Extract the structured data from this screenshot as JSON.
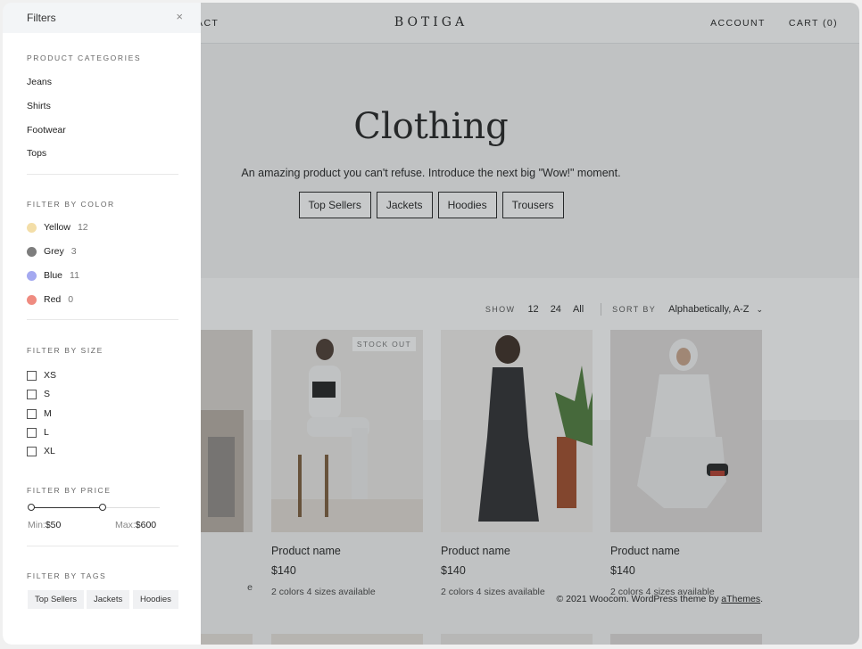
{
  "header": {
    "nav_left": "TACT",
    "logo": "BOTIGA",
    "account": "ACCOUNT",
    "cart": "CART (0)"
  },
  "hero": {
    "title": "Clothing",
    "description": "An amazing product you can't refuse. Introduce the next big \"Wow!\" moment.",
    "tags": [
      "Top Sellers",
      "Jackets",
      "Hoodies",
      "Trousers"
    ]
  },
  "toolbar": {
    "show_label": "SHOW",
    "show_options": [
      "12",
      "24",
      "All"
    ],
    "sort_label": "SORT BY",
    "sort_value": "Alphabetically, A-Z"
  },
  "products": [
    {
      "name": "Product name",
      "price": "$140",
      "meta": "2 colors 4 sizes available",
      "badge": "STOCK OUT"
    },
    {
      "name": "Product name",
      "price": "$140",
      "meta": "2 colors 4 sizes available"
    },
    {
      "name": "Product name",
      "price": "$140",
      "meta": "2 colors 4 sizes available"
    }
  ],
  "partial_product_meta": "e",
  "footer": {
    "text": "© 2021 Woocom. WordPress theme by ",
    "link": "aThemes",
    "end": "."
  },
  "filters": {
    "title": "Filters",
    "close_icon": "×",
    "categories_title": "PRODUCT CATEGORIES",
    "categories": [
      "Jeans",
      "Shirts",
      "Footwear",
      "Tops"
    ],
    "color_title": "FILTER BY COLOR",
    "colors": [
      {
        "name": "Yellow",
        "count": "12",
        "hex": "#f3dea8"
      },
      {
        "name": "Grey",
        "count": "3",
        "hex": "#7d7d7d"
      },
      {
        "name": "Blue",
        "count": "11",
        "hex": "#a4a9f0"
      },
      {
        "name": "Red",
        "count": "0",
        "hex": "#ef8b80"
      }
    ],
    "size_title": "FILTER BY SIZE",
    "sizes": [
      "XS",
      "S",
      "M",
      "L",
      "XL"
    ],
    "price_title": "FILTER BY PRICE",
    "price_min_label": "Min:",
    "price_min": "$50",
    "price_max_label": "Max:",
    "price_max": "$600",
    "tags_title": "FILTER BY TAGS",
    "tags": [
      "Top Sellers",
      "Jackets",
      "Hoodies"
    ]
  }
}
